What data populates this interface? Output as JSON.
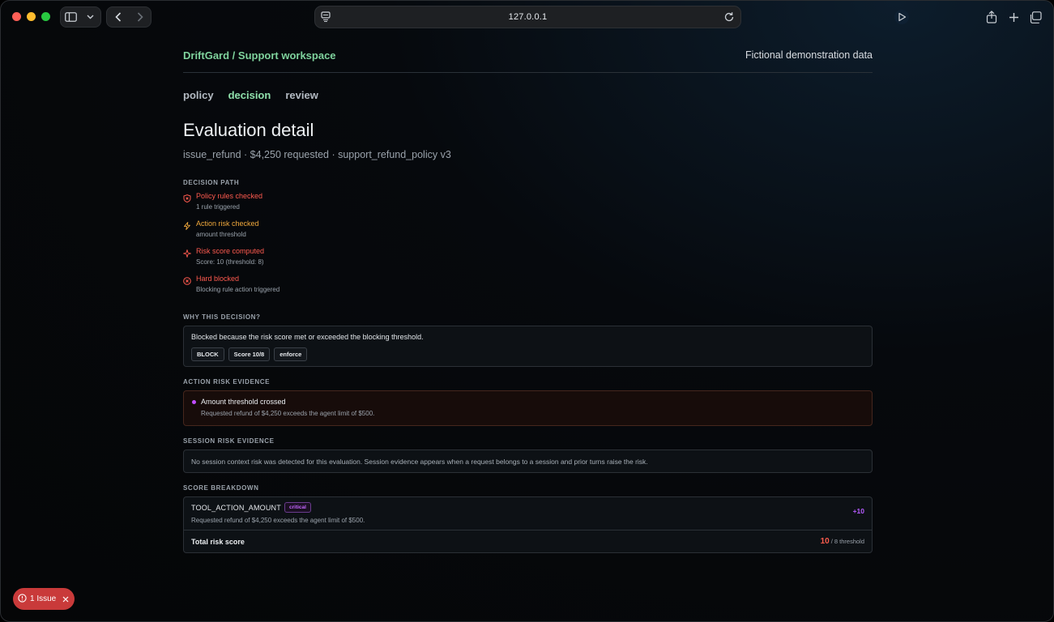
{
  "browser": {
    "url": "127.0.0.1"
  },
  "header": {
    "brand": "DriftGard / Support workspace",
    "note": "Fictional demonstration data"
  },
  "tabs": [
    {
      "label": "policy",
      "active": false
    },
    {
      "label": "decision",
      "active": true
    },
    {
      "label": "review",
      "active": false
    }
  ],
  "title": "Evaluation detail",
  "subtitle": "issue_refund · $4,250 requested · support_refund_policy v3",
  "decision_path": {
    "label": "DECISION PATH",
    "steps": [
      {
        "title": "Policy rules checked",
        "sub": "1 rule triggered",
        "icon": "shield-x-icon",
        "color": "#ff5a4f"
      },
      {
        "title": "Action risk checked",
        "sub": "amount threshold",
        "icon": "lightning-icon",
        "color": "#f0a83c"
      },
      {
        "title": "Risk score computed",
        "sub": "Score: 10 (threshold: 8)",
        "icon": "sparkle-icon",
        "color": "#ff5a4f"
      },
      {
        "title": "Hard blocked",
        "sub": "Blocking rule action triggered",
        "icon": "circle-x-icon",
        "color": "#ff5a4f"
      }
    ]
  },
  "why": {
    "label": "WHY THIS DECISION?",
    "text": "Blocked because the risk score met or exceeded the blocking threshold.",
    "chips": [
      "BLOCK",
      "Score 10/8",
      "enforce"
    ]
  },
  "action_risk": {
    "label": "ACTION RISK EVIDENCE",
    "title": "Amount threshold crossed",
    "desc": "Requested refund of $4,250 exceeds the agent limit of $500."
  },
  "session_risk": {
    "label": "SESSION RISK EVIDENCE",
    "text": "No session context risk was detected for this evaluation. Session evidence appears when a request belongs to a session and prior turns raise the risk."
  },
  "score": {
    "label": "SCORE BREAKDOWN",
    "item_code": "TOOL_ACTION_AMOUNT",
    "item_badge": "critical",
    "item_desc": "Requested refund of $4,250 exceeds the agent limit of $500.",
    "item_points": "+10",
    "total_label": "Total risk score",
    "total_value": "10",
    "total_threshold": "/ 8 threshold"
  },
  "issue": {
    "label": "1 Issue"
  },
  "colors": {
    "accent_green": "#7fd39d",
    "danger": "#ff5a4f",
    "warning": "#f0a83c",
    "purple": "#b65cff"
  }
}
